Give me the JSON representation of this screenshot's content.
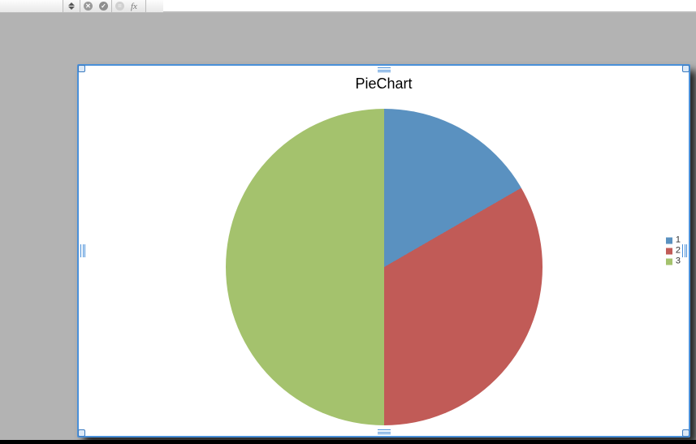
{
  "toolbar": {
    "fx_label": "fx"
  },
  "chart_data": {
    "type": "pie",
    "title": "PieChart",
    "series": [
      {
        "name": "1",
        "value": 1,
        "color": "#5a91c0"
      },
      {
        "name": "2",
        "value": 2,
        "color": "#c15b57"
      },
      {
        "name": "3",
        "value": 3,
        "color": "#a4c26d"
      }
    ],
    "legend_position": "right"
  }
}
